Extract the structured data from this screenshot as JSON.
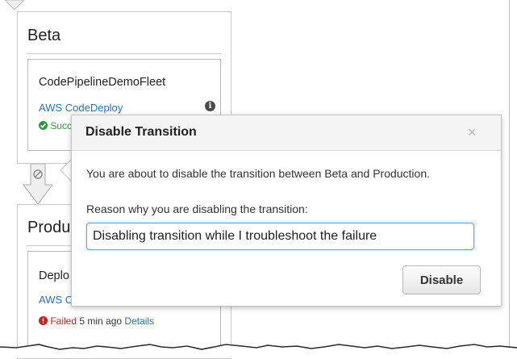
{
  "pipeline": {
    "beta": {
      "title": "Beta",
      "action": {
        "name": "CodePipelineDemoFleet",
        "provider": "AWS CodeDeploy",
        "status": "Succ"
      }
    },
    "production": {
      "title": "Produ",
      "action": {
        "name": "Deplo",
        "provider": "AWS C",
        "status": "Failed",
        "time": "5 min ago",
        "details_link": "Details"
      }
    }
  },
  "modal": {
    "title": "Disable Transition",
    "close_icon": "×",
    "message": "You are about to disable the transition between Beta and Production.",
    "reason_label": "Reason why you are disabling the transition:",
    "reason_value": "Disabling transition while I troubleshoot the failure",
    "button_label": "Disable"
  },
  "colors": {
    "link": "#2a6fbf",
    "success": "#2e9a3c",
    "failure": "#cc1f1f",
    "input_focus": "#66a8e0"
  },
  "icons": {
    "info": "info-icon",
    "success": "check-circle-icon",
    "failure": "exclamation-circle-icon",
    "transition_disabled": "no-entry-icon",
    "close": "close-icon"
  }
}
